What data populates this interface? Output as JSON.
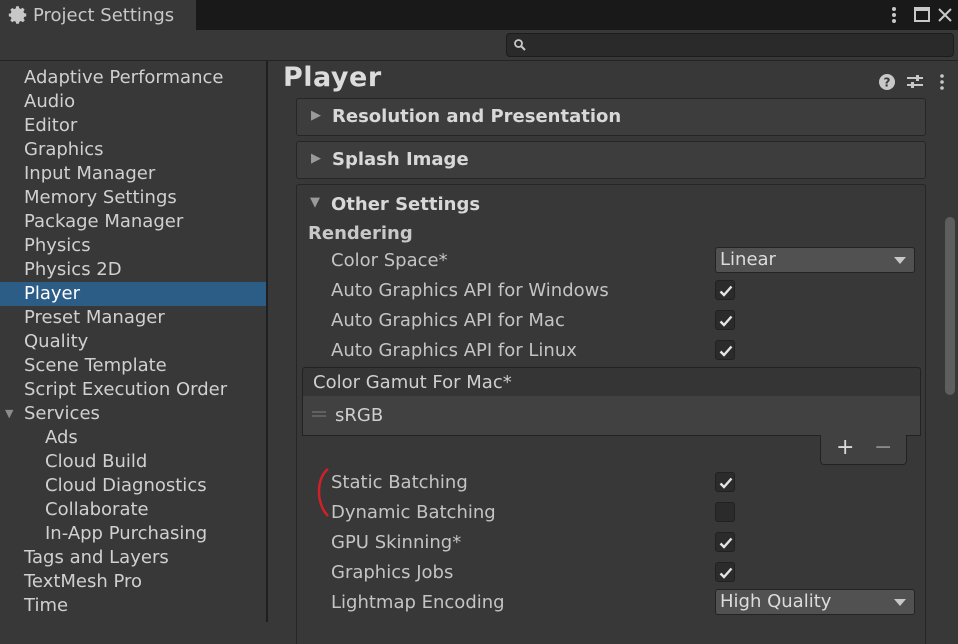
{
  "window": {
    "title": "Project Settings"
  },
  "search": {
    "placeholder": ""
  },
  "sidebar": {
    "items": [
      {
        "label": "Adaptive Performance"
      },
      {
        "label": "Audio"
      },
      {
        "label": "Editor"
      },
      {
        "label": "Graphics"
      },
      {
        "label": "Input Manager"
      },
      {
        "label": "Memory Settings"
      },
      {
        "label": "Package Manager"
      },
      {
        "label": "Physics"
      },
      {
        "label": "Physics 2D"
      },
      {
        "label": "Player",
        "selected": true
      },
      {
        "label": "Preset Manager"
      },
      {
        "label": "Quality"
      },
      {
        "label": "Scene Template"
      },
      {
        "label": "Script Execution Order"
      },
      {
        "label": "Services",
        "expanded": true
      },
      {
        "label": "Ads"
      },
      {
        "label": "Cloud Build"
      },
      {
        "label": "Cloud Diagnostics"
      },
      {
        "label": "Collaborate"
      },
      {
        "label": "In-App Purchasing"
      },
      {
        "label": "Tags and Layers"
      },
      {
        "label": "TextMesh Pro"
      },
      {
        "label": "Time"
      }
    ]
  },
  "main": {
    "title": "Player",
    "sections": {
      "resolution": "Resolution and Presentation",
      "splash": "Splash Image",
      "other": "Other Settings"
    },
    "rendering": {
      "heading": "Rendering",
      "color_space_label": "Color Space*",
      "color_space_value": "Linear",
      "auto_api_windows_label": "Auto Graphics API  for Windows",
      "auto_api_windows_checked": true,
      "auto_api_mac_label": "Auto Graphics API  for Mac",
      "auto_api_mac_checked": true,
      "auto_api_linux_label": "Auto Graphics API  for Linux",
      "auto_api_linux_checked": true,
      "color_gamut_header": "Color Gamut For Mac*",
      "color_gamut_items": [
        "sRGB"
      ],
      "list_add": "+",
      "list_remove": "−",
      "static_batching_label": "Static Batching",
      "static_batching_checked": true,
      "dynamic_batching_label": "Dynamic Batching",
      "dynamic_batching_checked": false,
      "gpu_skinning_label": "GPU Skinning*",
      "gpu_skinning_checked": true,
      "graphics_jobs_label": "Graphics Jobs",
      "graphics_jobs_checked": true,
      "lightmap_encoding_label": "Lightmap Encoding",
      "lightmap_encoding_value": "High Quality"
    }
  },
  "colors": {
    "selection": "#2c5d87",
    "background": "#383838",
    "annotation_arc": "#d0202a"
  }
}
